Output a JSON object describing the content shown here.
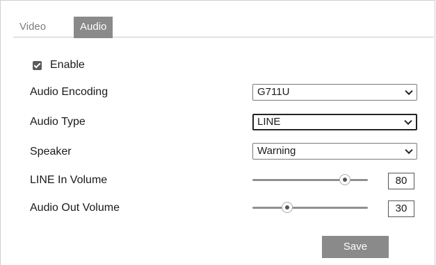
{
  "tabs": [
    {
      "label": "Video",
      "active": false
    },
    {
      "label": "Audio",
      "active": true
    }
  ],
  "enable": {
    "label": "Enable",
    "checked": true
  },
  "rows": {
    "audio_encoding": {
      "label": "Audio Encoding",
      "value": "G711U"
    },
    "audio_type": {
      "label": "Audio Type",
      "value": "LINE"
    },
    "speaker": {
      "label": "Speaker",
      "value": "Warning"
    },
    "line_in_volume": {
      "label": "LINE In Volume",
      "value": "80",
      "level": 80
    },
    "audio_out_volume": {
      "label": "Audio Out Volume",
      "value": "30",
      "level": 30
    }
  },
  "save_label": "Save",
  "colors": {
    "tab_active": "#8a8a8a",
    "button": "#8a8a8a",
    "checkbox": "#5b5b5b"
  },
  "icons": {
    "dropdown": "chevron-down-icon",
    "checkbox": "checkmark-icon"
  }
}
